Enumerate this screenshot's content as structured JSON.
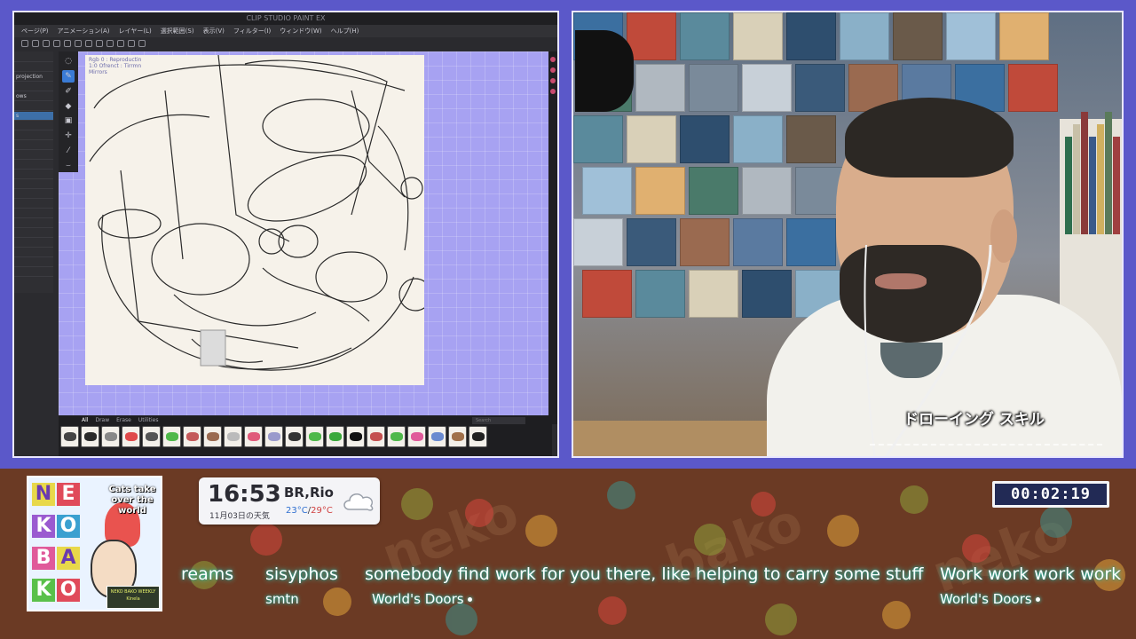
{
  "app": {
    "title": "CLIP STUDIO PAINT EX",
    "menu": [
      "ページ(P)",
      "アニメーション(A)",
      "レイヤー(L)",
      "選択範囲(S)",
      "表示(V)",
      "フィルター(I)",
      "ウィンドウ(W)",
      "ヘルプ(H)"
    ],
    "left_palette": [
      "",
      "",
      "projection",
      "",
      "ows",
      "",
      "s",
      "",
      "",
      "",
      "",
      "",
      "",
      "",
      "",
      "",
      "",
      "",
      "",
      "",
      "",
      "",
      ""
    ],
    "layer_note": [
      "Rgb 0 : Reproductin",
      "1:0 Ofrenct : Tirrmn",
      "Mirrors"
    ],
    "tools": [
      "pen-tool",
      "brush-tool",
      "eraser-tool",
      "fill-tool",
      "color-tool",
      "select-tool",
      "wand-tool",
      "hand-tool",
      "zoom-tool"
    ],
    "brush_tabs": [
      "All",
      "Draw",
      "Erase",
      "Utilities"
    ],
    "brush_search_placeholder": "Search",
    "brush_colors": [
      "#444444",
      "#2a2a2a",
      "#888888",
      "#e04a4a",
      "#555555",
      "#4fb84a",
      "#c45a5a",
      "#9a6a50",
      "#bbbbbb",
      "#e05a7a",
      "#9a9acc",
      "#333333",
      "#4fb84a",
      "#3aa83a",
      "#111111",
      "#c45050",
      "#4fb84a",
      "#e05a9a",
      "#6a8ad0",
      "#a0704a",
      "#222222"
    ]
  },
  "cam": {
    "caption": "ドローイング スキル"
  },
  "widget": {
    "time": "16:53",
    "date": "11月03日の天気",
    "city": "BR,Rio",
    "temp_low": "23°C",
    "temp_sep": "/",
    "temp_high": "29°C",
    "weather_icon": "cloud-icon"
  },
  "timer": "00:02:19",
  "logo": {
    "letters": [
      "N",
      "E",
      "K",
      "O",
      "B",
      "A",
      "K",
      "O"
    ],
    "tagline": "Cats take over the world",
    "badge": "NEKO BAKO WEEKLY Kinela"
  },
  "ticker": [
    {
      "title": "reams",
      "subtitle": ""
    },
    {
      "title": "sisyphos",
      "subtitle": "smtn"
    },
    {
      "title": "somebody find work for you there, like helping to carry some stuff",
      "subtitle": "World's Doors"
    },
    {
      "title": "Work work work work",
      "subtitle": "World's Doors"
    }
  ],
  "colors": {
    "canvas_bg": "#a7a2f2",
    "band_bg": "#6b3a24",
    "glow": "#2fe6d2",
    "timer_bg": "#222a55"
  }
}
